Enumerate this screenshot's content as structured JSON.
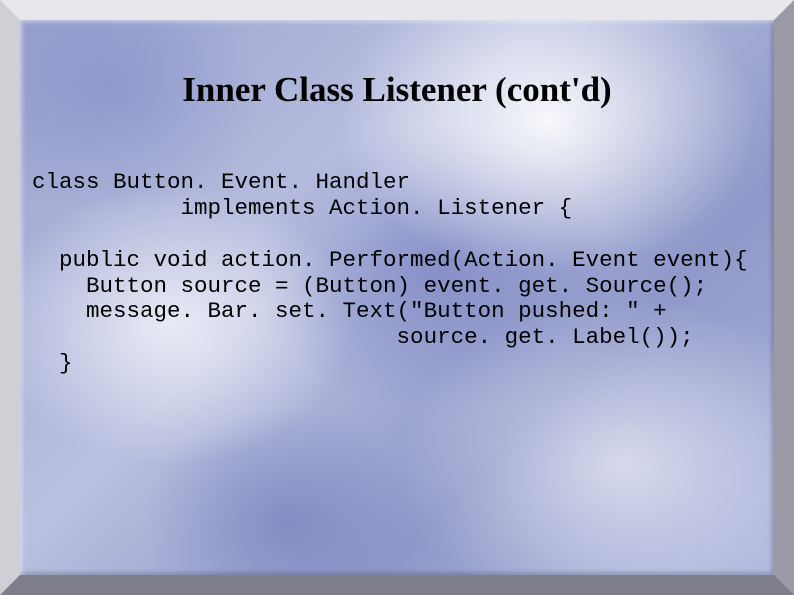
{
  "slide": {
    "title": "Inner Class Listener (cont'd)",
    "code": "class Button. Event. Handler\n           implements Action. Listener {\n\n  public void action. Performed(Action. Event event){\n    Button source = (Button) event. get. Source();\n    message. Bar. set. Text(\"Button pushed: \" +\n                           source. get. Label());\n  }"
  }
}
